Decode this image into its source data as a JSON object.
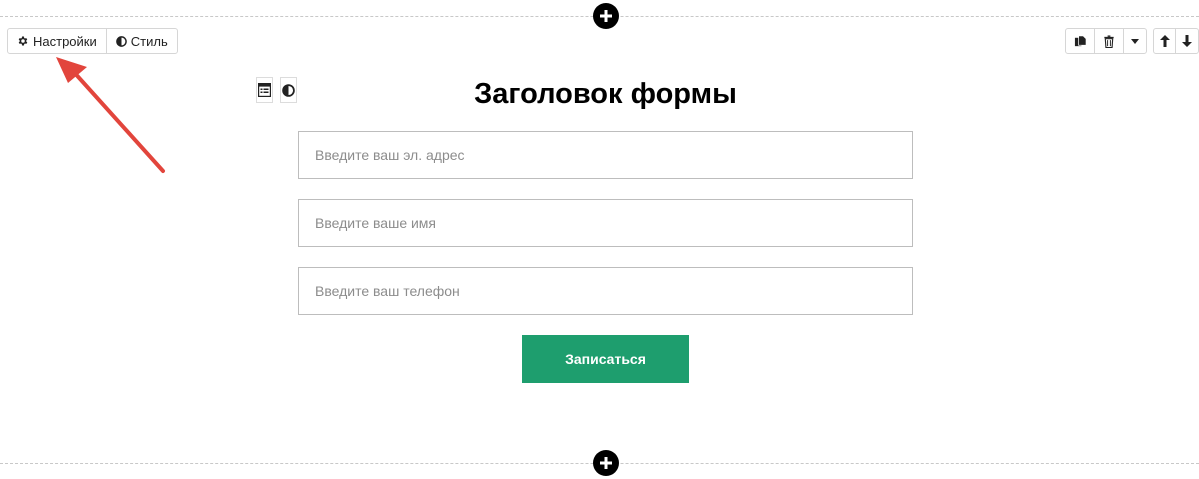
{
  "toolbar": {
    "settings_label": "Настройки",
    "style_label": "Стиль"
  },
  "form": {
    "title": "Заголовок формы",
    "email_placeholder": "Введите ваш эл. адрес",
    "name_placeholder": "Введите ваше имя",
    "phone_placeholder": "Введите ваш телефон",
    "submit_label": "Записаться"
  },
  "icons": {
    "add_block": "plus-circle-icon",
    "settings": "gear-icon",
    "style": "contrast-icon",
    "copy": "copy-icon",
    "delete": "trash-icon",
    "more": "caret-down-icon",
    "move_up": "arrow-up-icon",
    "move_down": "arrow-down-icon",
    "form_settings": "form-list-icon",
    "form_style": "contrast-icon",
    "annotation": "red-arrow-icon"
  },
  "colors": {
    "submit_bg": "#1e9e6e",
    "annotation_arrow": "#e2453c",
    "title_text": "#000000"
  }
}
